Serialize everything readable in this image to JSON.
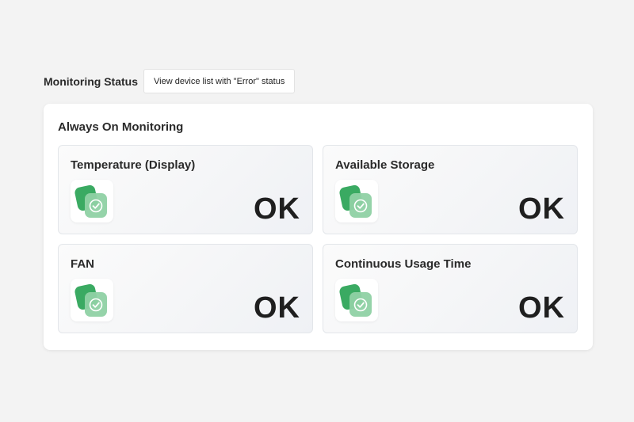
{
  "header": {
    "title": "Monitoring Status",
    "error_list_button_label": "View device list with \"Error\" status"
  },
  "panel": {
    "title": "Always On Monitoring",
    "cards": [
      {
        "title": "Temperature (Display)",
        "value": "OK",
        "icon": "shield-check-icon"
      },
      {
        "title": "Available Storage",
        "value": "OK",
        "icon": "shield-check-icon"
      },
      {
        "title": "FAN",
        "value": "OK",
        "icon": "shield-check-icon"
      },
      {
        "title": "Continuous Usage Time",
        "value": "OK",
        "icon": "shield-check-icon"
      }
    ]
  },
  "colors": {
    "ok_green": "#3aaa62",
    "ok_green_light": "#8fd1a4",
    "background": "#f3f3f3",
    "panel": "#ffffff"
  }
}
